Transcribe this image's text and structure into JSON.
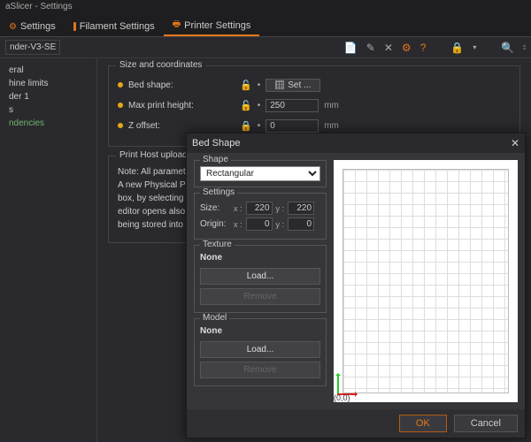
{
  "window": {
    "title": "aSlicer - Settings"
  },
  "tabs": [
    {
      "label": "Settings"
    },
    {
      "label": "Filament Settings"
    },
    {
      "label": "Printer Settings"
    }
  ],
  "printer_select": "nder-V3-SE",
  "sidebar": {
    "items": [
      {
        "label": "eral"
      },
      {
        "label": "hine limits"
      },
      {
        "label": "der 1"
      },
      {
        "label": "s"
      },
      {
        "label": "ndencies",
        "green": true
      }
    ]
  },
  "size_section": {
    "legend": "Size and coordinates",
    "bed_shape_label": "Bed shape:",
    "set_btn": "Set ...",
    "max_height_label": "Max print height:",
    "max_height_value": "250",
    "z_offset_label": "Z offset:",
    "z_offset_value": "0",
    "unit": "mm"
  },
  "host_section": {
    "legend": "Print Host upload",
    "note1": "Note: All parameters",
    "note2": "A new Physical Printe",
    "note3": "box, by selecting the",
    "note4": "editor opens also wh",
    "note5": "being stored into Pru"
  },
  "dialog": {
    "title": "Bed Shape",
    "shape": {
      "legend": "Shape",
      "value": "Rectangular"
    },
    "settings": {
      "legend": "Settings",
      "size_label": "Size:",
      "origin_label": "Origin:",
      "x_label": "x :",
      "y_label": "y :",
      "size_x": "220",
      "size_y": "220",
      "origin_x": "0",
      "origin_y": "0"
    },
    "texture": {
      "legend": "Texture",
      "none": "None",
      "load": "Load...",
      "remove": "Remove"
    },
    "model": {
      "legend": "Model",
      "none": "None",
      "load": "Load...",
      "remove": "Remove"
    },
    "origin_coord": "(0,0)",
    "ok": "OK",
    "cancel": "Cancel"
  }
}
